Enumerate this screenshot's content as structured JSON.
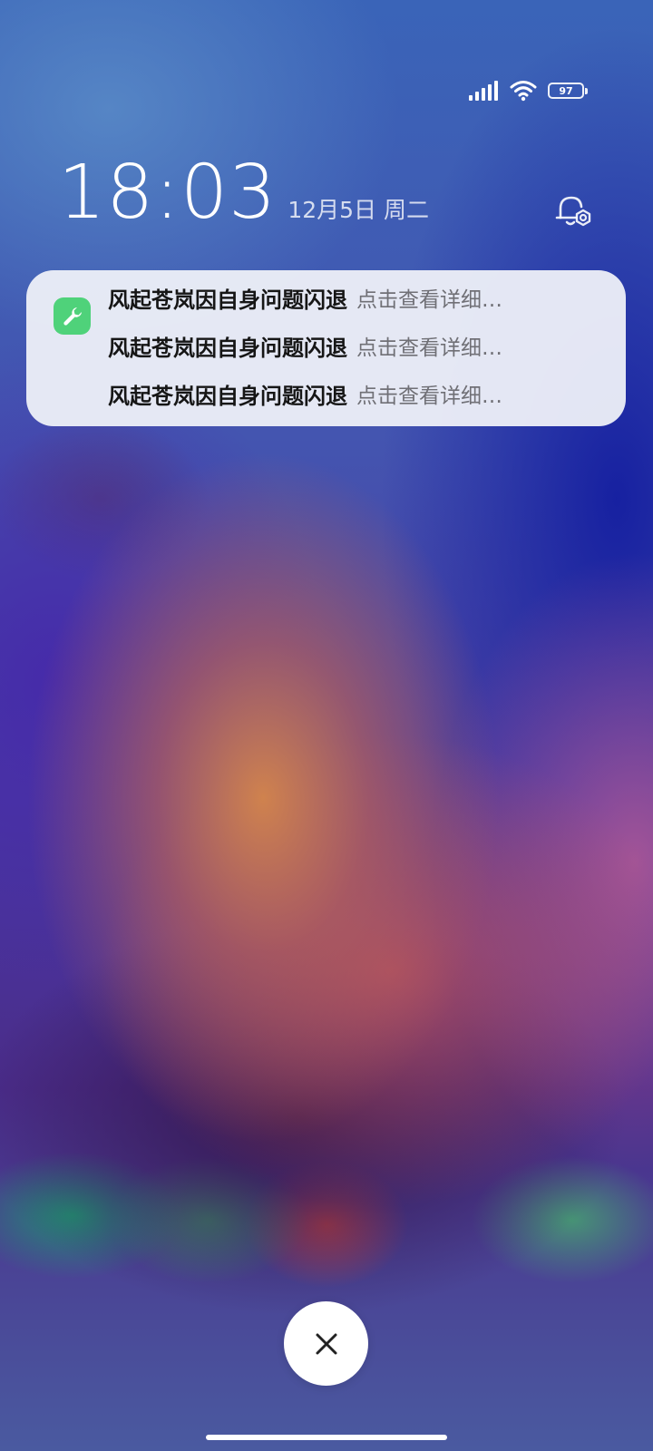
{
  "status_bar": {
    "battery_level": "97",
    "signal_icon": "signal-bars-icon",
    "wifi_icon": "wifi-icon"
  },
  "lock_screen": {
    "time": "18:03",
    "date": "12月5日 周二",
    "settings_icon": "notification-settings-icon"
  },
  "notification": {
    "app_icon": "wrench-icon",
    "app_icon_color": "#4fd27a",
    "items": [
      {
        "title": "风起苍岚因自身问题闪退",
        "body": "点击查看详细…"
      },
      {
        "title": "风起苍岚因自身问题闪退",
        "body": "点击查看详细…"
      },
      {
        "title": "风起苍岚因自身问题闪退",
        "body": "点击查看详细…"
      }
    ]
  },
  "dismiss": {
    "icon": "close-icon"
  }
}
